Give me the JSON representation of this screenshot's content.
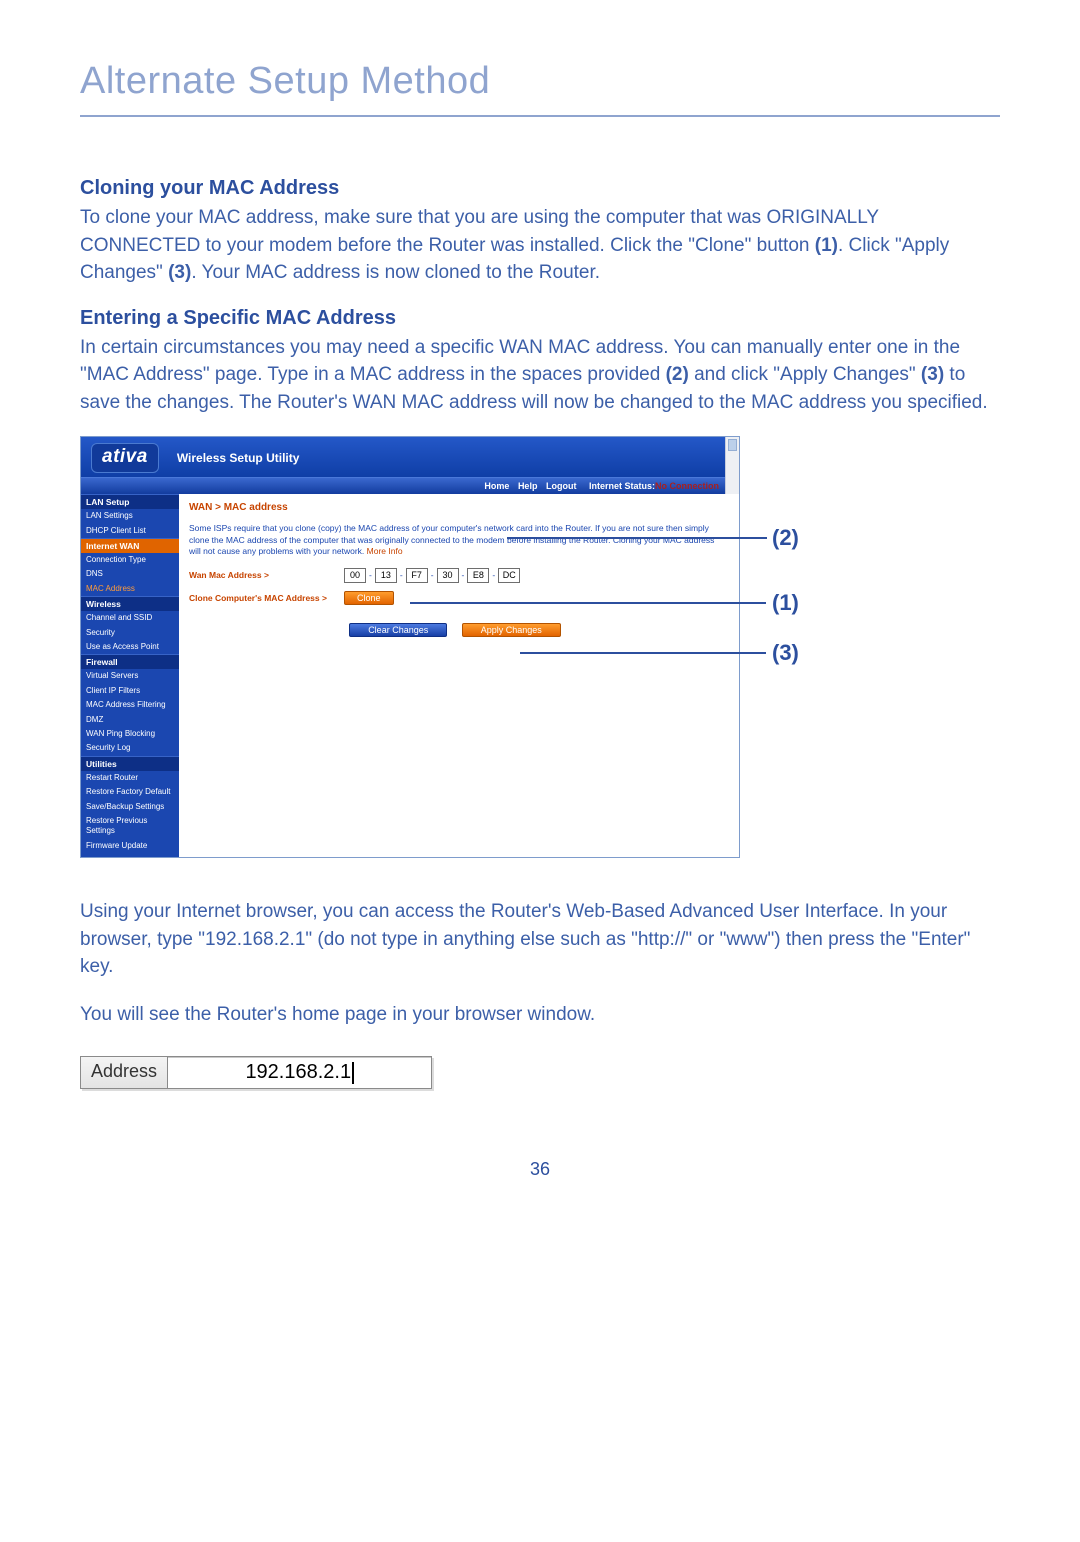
{
  "page": {
    "title": "Alternate Setup Method",
    "number": "36"
  },
  "section1": {
    "heading": "Cloning your MAC Address",
    "p1a": "To clone your MAC address, make sure that you are using the computer that was ORIGINALLY CONNECTED to your modem before the Router was installed. Click the \"Clone\" button ",
    "p1b": "(1)",
    "p1c": ". Click \"Apply Changes\" ",
    "p1d": "(3)",
    "p1e": ". Your MAC address is now cloned to the Router."
  },
  "section2": {
    "heading": "Entering a Specific MAC Address",
    "p1a": "In certain circumstances you may need a specific WAN MAC address. You can manually enter one in the \"MAC Address\" page. Type in a MAC address in the spaces provided ",
    "p1b": "(2)",
    "p1c": " and click \"Apply Changes\" ",
    "p1d": "(3)",
    "p1e": " to save the changes. The Router's WAN MAC address will now be changed to the MAC address you specified."
  },
  "ui": {
    "logo": "ativa",
    "title": "Wireless Setup Utility",
    "toolbar": {
      "home": "Home",
      "help": "Help",
      "logout": "Logout",
      "status_label": "Internet Status:",
      "status_value": "No Connection"
    },
    "sidebar": {
      "sections": [
        {
          "header": "LAN Setup",
          "hclass": "",
          "items": [
            "LAN Settings",
            "DHCP Client List"
          ]
        },
        {
          "header": "Internet WAN",
          "hclass": "orange",
          "items": [
            "Connection Type",
            "DNS"
          ],
          "orange_item": "MAC Address"
        },
        {
          "header": "Wireless",
          "hclass": "",
          "items": [
            "Channel and SSID",
            "Security",
            "Use as Access Point"
          ]
        },
        {
          "header": "Firewall",
          "hclass": "",
          "items": [
            "Virtual Servers",
            "Client IP Filters",
            "MAC Address Filtering",
            "DMZ",
            "WAN Ping Blocking",
            "Security Log"
          ]
        },
        {
          "header": "Utilities",
          "hclass": "",
          "items": [
            "Restart Router",
            "Restore Factory Default",
            "Save/Backup Settings",
            "Restore Previous Settings",
            "Firmware Update"
          ]
        }
      ]
    },
    "content": {
      "breadcrumb": "WAN > MAC address",
      "desc": "Some ISPs require that you clone (copy) the MAC address of your computer's network card into the Router. If you are not sure then simply clone the MAC address of the computer that was originally connected to the modem before installing the Router. Cloning your MAC address will not cause any problems with your network. ",
      "more": "More Info",
      "wan_mac_label": "Wan Mac Address >",
      "mac": [
        "00",
        "13",
        "F7",
        "30",
        "E8",
        "DC"
      ],
      "clone_label": "Clone Computer's MAC Address >",
      "clone_btn": "Clone",
      "clear_btn": "Clear Changes",
      "apply_btn": "Apply Changes"
    }
  },
  "callouts": {
    "c2": "(2)",
    "c1": "(1)",
    "c3": "(3)"
  },
  "after_text": {
    "p1": "Using your Internet browser, you can access the Router's Web-Based Advanced User Interface. In your browser, type \"192.168.2.1\" (do not type in anything else such as \"http://\" or \"www\") then press the \"Enter\" key.",
    "p2": "You will see the Router's home page in your browser window."
  },
  "address_bar": {
    "label": "Address",
    "value": "192.168.2.1"
  }
}
